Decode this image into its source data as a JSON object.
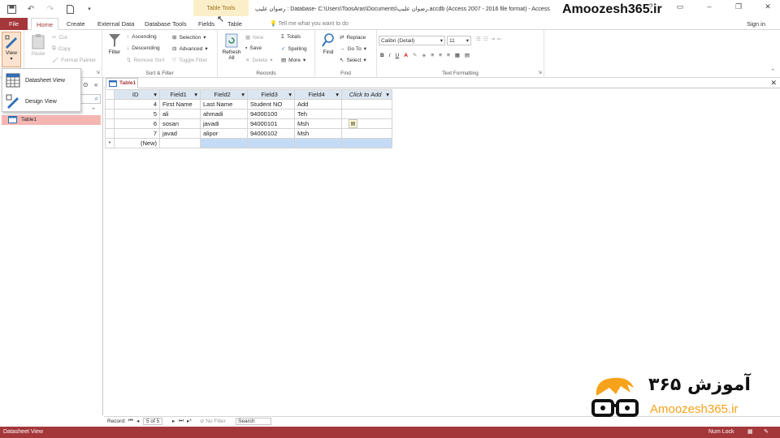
{
  "titlebar": {
    "context_tools": "Table Tools",
    "window_title": "رضوان علیپ : Database- C:\\Users\\ToosAras\\Documents\\رضوان علیپ.accdb (Access 2007 - 2016 file format) - Access",
    "watermark": "Amoozesh365.ir",
    "help": "?"
  },
  "tabs": [
    "File",
    "Home",
    "Create",
    "External Data",
    "Database Tools",
    "Fields",
    "Table"
  ],
  "tell_me": "Tell me what you want to do",
  "sign_in": "Sign in",
  "ribbon": {
    "views": {
      "view": "View",
      "label": ""
    },
    "clipboard": {
      "paste": "Paste",
      "cut": "Cut",
      "copy": "Copy",
      "format_painter": "Format Painter",
      "label": ""
    },
    "sort_filter": {
      "filter": "Filter",
      "ascending": "Ascending",
      "descending": "Descending",
      "remove_sort": "Remove Sort",
      "selection": "Selection",
      "advanced": "Advanced",
      "toggle_filter": "Toggle Filter",
      "label": "Sort & Filter"
    },
    "records": {
      "refresh": "Refresh All",
      "new": "New",
      "save": "Save",
      "delete": "Delete",
      "totals": "Totals",
      "spelling": "Spelling",
      "more": "More",
      "label": "Records"
    },
    "find": {
      "find": "Find",
      "replace": "Replace",
      "goto": "Go To",
      "select": "Select",
      "label": "Find"
    },
    "text_formatting": {
      "font": "Calibri (Detail)",
      "size": "11",
      "label": "Text Formatting"
    }
  },
  "view_menu": {
    "datasheet": "Datasheet View",
    "design": "Design View"
  },
  "nav": {
    "item": "Table1"
  },
  "doc_tab": "Table1",
  "table": {
    "headers": [
      "ID",
      "Field1",
      "Field2",
      "Field3",
      "Field4",
      "Click to Add"
    ],
    "rows": [
      [
        "4",
        "First Name",
        "Last Name",
        "Student NO",
        "Add"
      ],
      [
        "5",
        "ali",
        "ahmadi",
        "94000100",
        "Teh"
      ],
      [
        "6",
        "sosan",
        "javadi",
        "94000101",
        "Msh"
      ],
      [
        "7",
        "javad",
        "alipor",
        "94000102",
        "Msh"
      ]
    ],
    "new_label": "(New)",
    "new_marker": "*"
  },
  "status": {
    "record_label": "Record:",
    "position": "5 of 5",
    "filter": "No Filter",
    "search": "Search"
  },
  "bottom": {
    "mode": "Datasheet View",
    "numlock": "Num Lock"
  },
  "logo": {
    "persian": "آموزش ۳۶۵",
    "site": "Amoozesh365.ir"
  },
  "colors": {
    "accent": "#a4373a",
    "context": "#fbefc9",
    "header": "#dce6f1",
    "new_row": "#c5daf4",
    "nav_sel": "#f4b6b2"
  }
}
